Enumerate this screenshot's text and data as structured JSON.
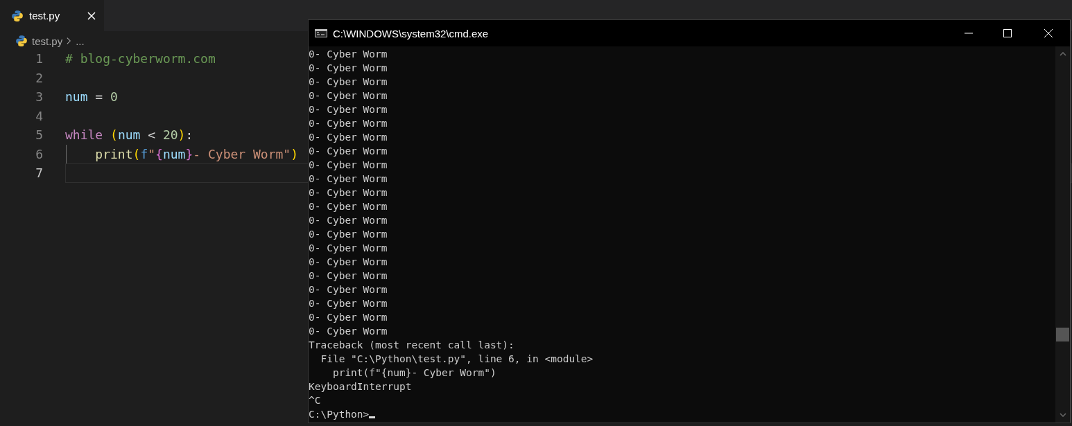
{
  "editor": {
    "tab": {
      "label": "test.py",
      "selected": true
    },
    "breadcrumb": {
      "file": "test.py",
      "more": "..."
    },
    "lines": [
      {
        "number": "1",
        "current": false,
        "tokens": [
          {
            "kind": "comment",
            "text": "# blog-cyberworm.com"
          }
        ]
      },
      {
        "number": "2",
        "current": false
      },
      {
        "number": "3",
        "current": false,
        "tokens": [
          {
            "kind": "variable",
            "text": "num"
          },
          {
            "kind": "operator",
            "text": " = "
          },
          {
            "kind": "number",
            "text": "0"
          }
        ]
      },
      {
        "number": "4",
        "current": false
      },
      {
        "number": "5",
        "current": false,
        "tokens": [
          {
            "kind": "keyword",
            "text": "while "
          },
          {
            "kind": "bracket",
            "text": "("
          },
          {
            "kind": "variable",
            "text": "num"
          },
          {
            "kind": "operator",
            "text": " < "
          },
          {
            "kind": "number",
            "text": "20"
          },
          {
            "kind": "bracket",
            "text": ")"
          },
          {
            "kind": "operator",
            "text": ":"
          }
        ]
      },
      {
        "number": "6",
        "current": false,
        "indent_guide": true,
        "tokens": [
          {
            "kind": "function",
            "text": "    print"
          },
          {
            "kind": "bracket",
            "text": "("
          },
          {
            "kind": "prefix",
            "text": "f"
          },
          {
            "kind": "string",
            "text": "\""
          },
          {
            "kind": "brace",
            "text": "{"
          },
          {
            "kind": "variable",
            "text": "num"
          },
          {
            "kind": "brace",
            "text": "}"
          },
          {
            "kind": "string",
            "text": "- Cyber Worm\""
          },
          {
            "kind": "bracket",
            "text": ")"
          }
        ]
      },
      {
        "number": "7",
        "current": true
      }
    ]
  },
  "terminal": {
    "title": "C:\\WINDOWS\\system32\\cmd.exe",
    "lines": [
      "0- Cyber Worm",
      "0- Cyber Worm",
      "0- Cyber Worm",
      "0- Cyber Worm",
      "0- Cyber Worm",
      "0- Cyber Worm",
      "0- Cyber Worm",
      "0- Cyber Worm",
      "0- Cyber Worm",
      "0- Cyber Worm",
      "0- Cyber Worm",
      "0- Cyber Worm",
      "0- Cyber Worm",
      "0- Cyber Worm",
      "0- Cyber Worm",
      "0- Cyber Worm",
      "0- Cyber Worm",
      "0- Cyber Worm",
      "0- Cyber Worm",
      "0- Cyber Worm",
      "0- Cyber Worm",
      "Traceback (most recent call last):",
      "  File \"C:\\Python\\test.py\", line 6, in <module>",
      "    print(f\"{num}- Cyber Worm\")",
      "KeyboardInterrupt",
      "^C"
    ],
    "prompt": "C:\\Python>",
    "cursor": true
  }
}
